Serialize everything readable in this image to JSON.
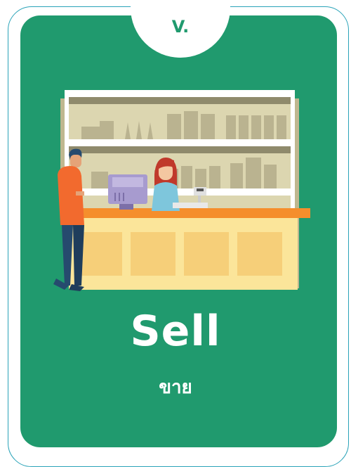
{
  "card": {
    "tab_label": "V.",
    "word": "Sell",
    "translation": "ขาย",
    "illustration_icon": "shop-counter-illustration"
  },
  "colors": {
    "card_bg": "#209a6e",
    "border": "#2aa3b8",
    "tab_bg": "#ffffff",
    "text": "#ffffff"
  }
}
